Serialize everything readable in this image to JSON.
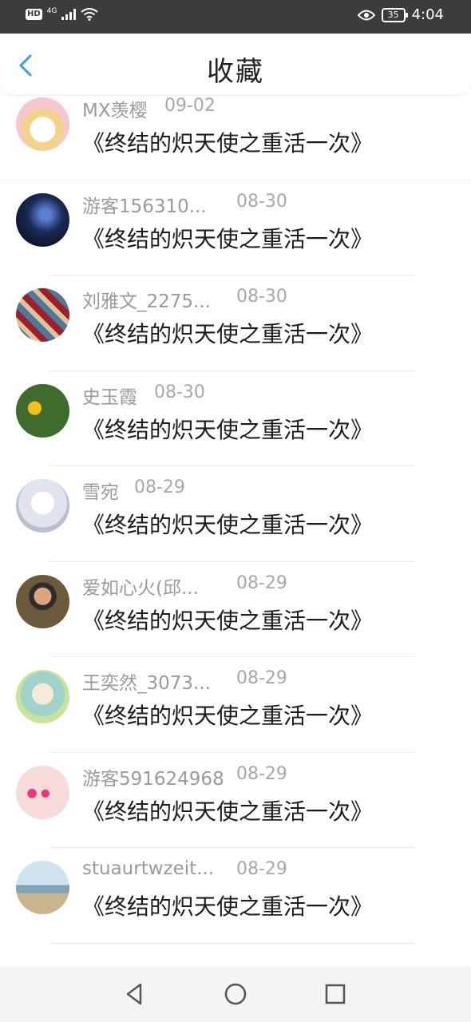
{
  "status": {
    "network": "4G",
    "hd": "HD",
    "battery": "35",
    "time": "4:04"
  },
  "header": {
    "title": "收藏"
  },
  "items": [
    {
      "name": "MX羡樱",
      "date": "09-02",
      "book": "《终结的炽天使之重活一次》",
      "avatar_color": "#f7c7cf"
    },
    {
      "name": "游客156310...",
      "date": "08-30",
      "book": "《终结的炽天使之重活一次》",
      "avatar_color": "#1a2b55"
    },
    {
      "name": "刘雅文_2275...",
      "date": "08-30",
      "book": "《终结的炽天使之重活一次》",
      "avatar_color": "#9d1f2a"
    },
    {
      "name": "史玉霞",
      "date": "08-30",
      "book": "《终结的炽天使之重活一次》",
      "avatar_color": "#3f6b2c"
    },
    {
      "name": "雪宛",
      "date": "08-29",
      "book": "《终结的炽天使之重活一次》",
      "avatar_color": "#dfe4ee"
    },
    {
      "name": "爱如心火(邱...",
      "date": "08-29",
      "book": "《终结的炽天使之重活一次》",
      "avatar_color": "#6b5a3c"
    },
    {
      "name": "王奕然_3073...",
      "date": "08-29",
      "book": "《终结的炽天使之重活一次》",
      "avatar_color": "#9fd3c9"
    },
    {
      "name": "游客591624968",
      "date": "08-29",
      "book": "《终结的炽天使之重活一次》",
      "avatar_color": "#f3c9c9"
    },
    {
      "name": "stuaurtwzeit...",
      "date": "08-29",
      "book": "《终结的炽天使之重活一次》",
      "avatar_color": "#7fa4b9"
    }
  ],
  "colors": {
    "accent": "#3aa0e8",
    "status_bg": "#3c3c3c",
    "nav_bg": "#f4f4f4"
  }
}
